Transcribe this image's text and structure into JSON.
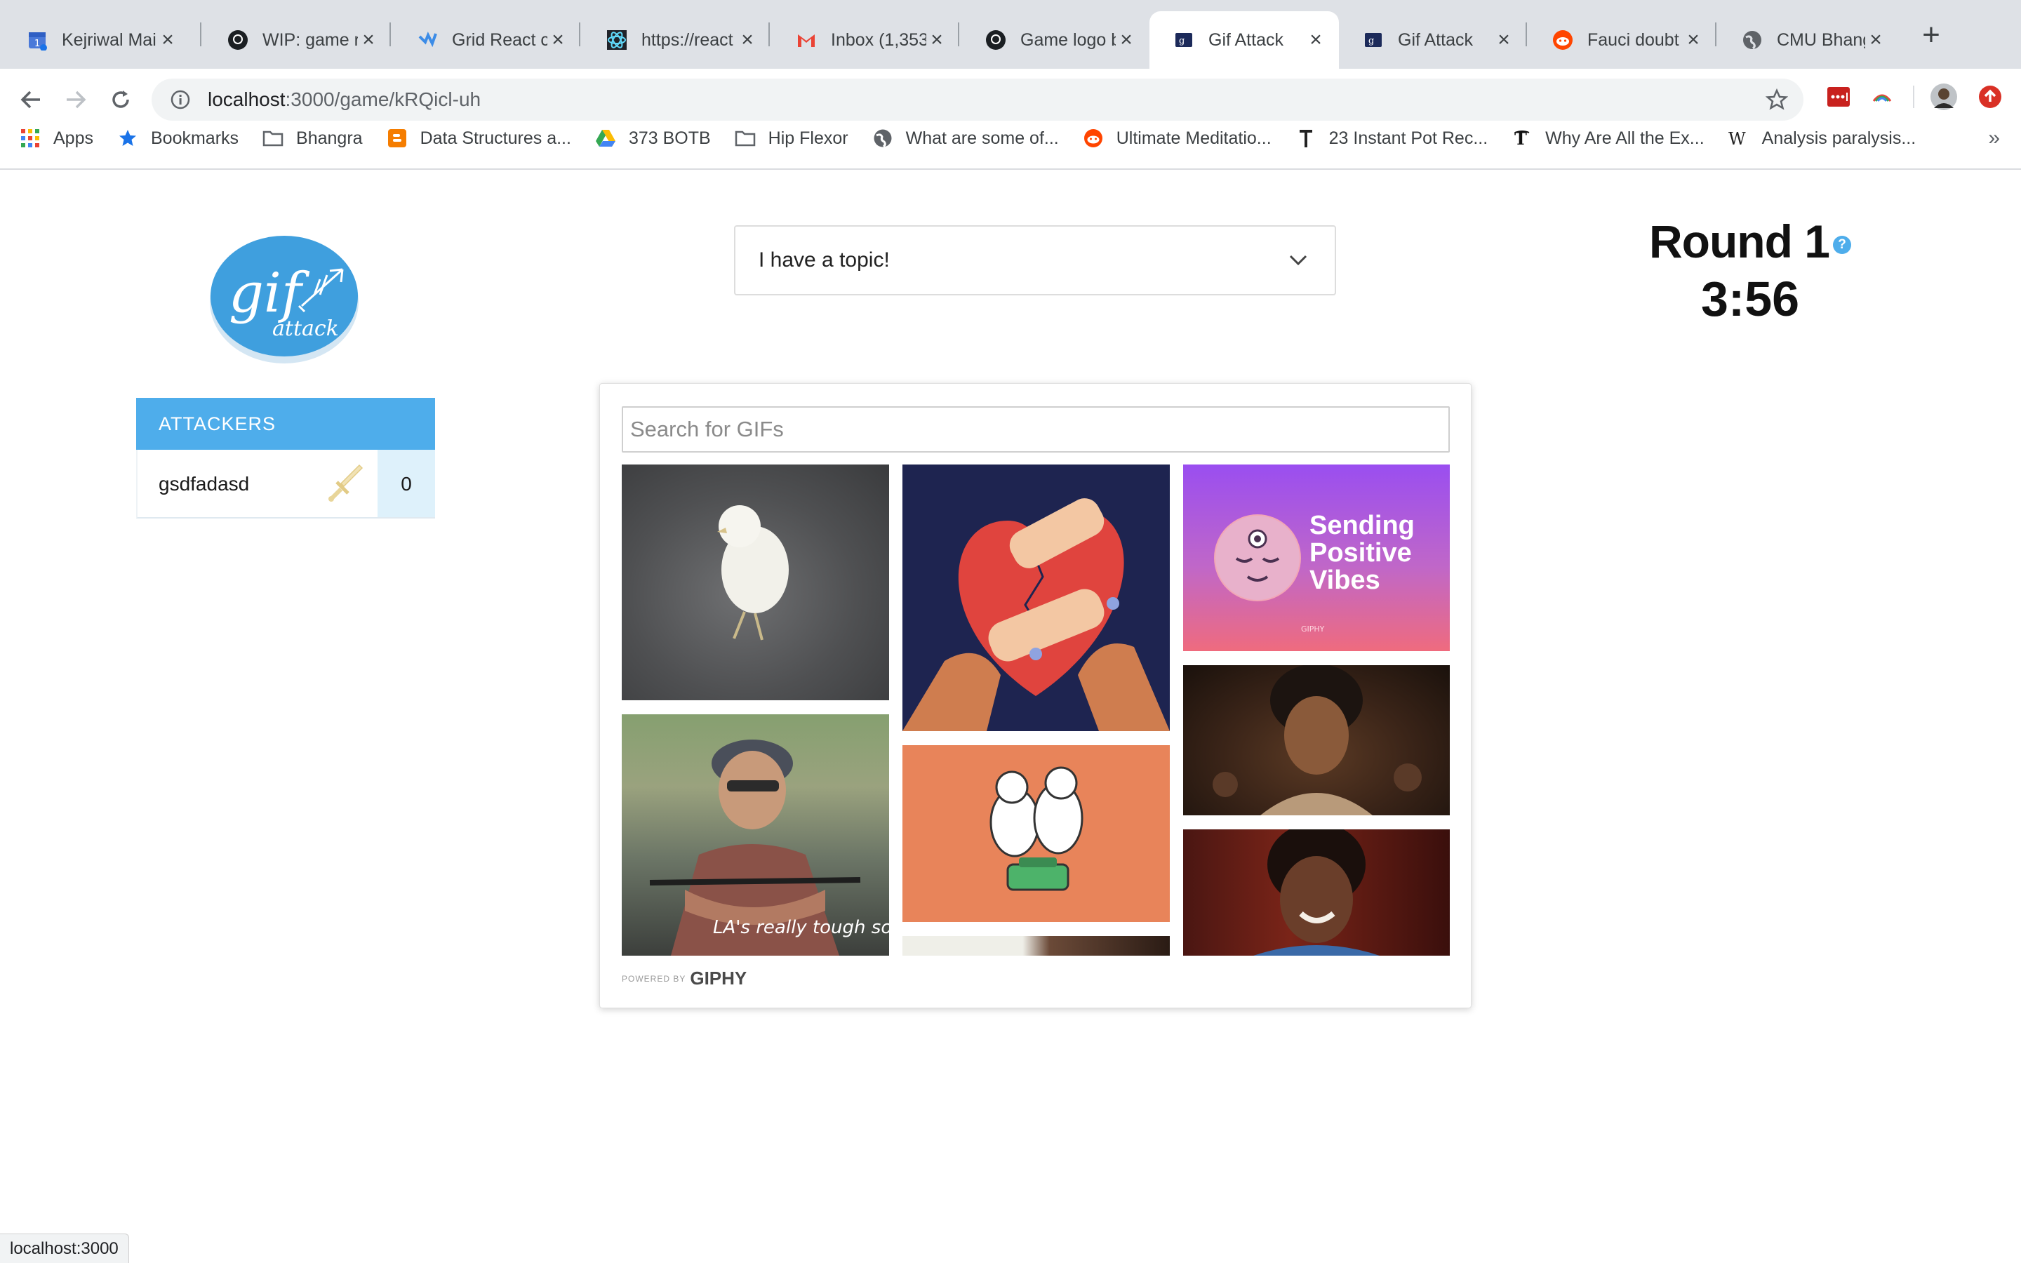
{
  "browser": {
    "tabs": [
      {
        "title": "Kejriwal Mail",
        "icon": "calendar-icon"
      },
      {
        "title": "WIP: game r",
        "icon": "github-icon"
      },
      {
        "title": "Grid React c",
        "icon": "react-grid-icon"
      },
      {
        "title": "https://react",
        "icon": "react-icon"
      },
      {
        "title": "Inbox (1,353",
        "icon": "gmail-icon"
      },
      {
        "title": "Game logo b",
        "icon": "github-icon"
      },
      {
        "title": "Gif Attack",
        "icon": "gif-attack-icon"
      },
      {
        "title": "Gif Attack",
        "icon": "gif-attack-icon"
      },
      {
        "title": "Fauci doubt",
        "icon": "reddit-icon"
      },
      {
        "title": "CMU Bhang",
        "icon": "globe-icon"
      }
    ],
    "url_host": "localhost",
    "url_path": ":3000/game/kRQicl-uh",
    "bookmarks": [
      {
        "label": "Apps",
        "icon": "apps-icon"
      },
      {
        "label": "Bookmarks",
        "icon": "star-icon"
      },
      {
        "label": "Bhangra",
        "icon": "folder-icon"
      },
      {
        "label": "Data Structures a...",
        "icon": "blogger-icon"
      },
      {
        "label": "373 BOTB",
        "icon": "drive-icon"
      },
      {
        "label": "Hip Flexor",
        "icon": "folder-icon"
      },
      {
        "label": "What are some of...",
        "icon": "globe-icon"
      },
      {
        "label": "Ultimate Meditatio...",
        "icon": "reddit-icon"
      },
      {
        "label": "23 Instant Pot Rec...",
        "icon": "t-icon"
      },
      {
        "label": "Why Are All the Ex...",
        "icon": "nyt-icon"
      },
      {
        "label": "Analysis paralysis...",
        "icon": "wikipedia-icon"
      }
    ],
    "bookmarks_more": "»",
    "status_url": "localhost:3000"
  },
  "game": {
    "logo_text_main": "gif",
    "logo_text_sub": "attack",
    "attackers_heading": "ATTACKERS",
    "players": [
      {
        "name": "gsdfadasd",
        "score": "0"
      }
    ],
    "topic_label": "I have a topic!",
    "round_label": "Round 1",
    "help_glyph": "?",
    "timer": "3:56",
    "search_placeholder": "Search for GIFs",
    "gif_captions": {
      "positive_vibes": "Sending Positive Vibes",
      "giphy_watermark": "GIPHY",
      "la_caption": "LA's really tough sometimes."
    },
    "powered_by": "POWERED BY",
    "powered_name": "GIPHY"
  },
  "colors": {
    "accent": "#4eadeb",
    "score_bg": "#def1fb",
    "tabstrip": "#dee1e6"
  }
}
